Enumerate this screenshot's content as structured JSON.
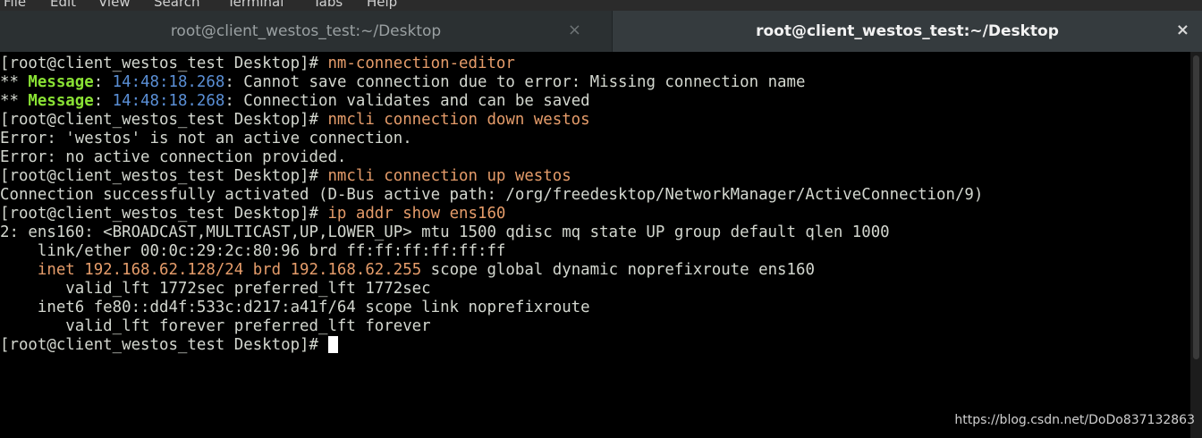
{
  "menubar": {
    "items": [
      "File",
      "Edit",
      "View",
      "Search",
      "Terminal",
      "Tabs",
      "Help"
    ]
  },
  "tabs": [
    {
      "title": "root@client_westos_test:~/Desktop",
      "close": "×",
      "active": false
    },
    {
      "title": "root@client_westos_test:~/Desktop",
      "close": "×",
      "active": true
    }
  ],
  "terminal": {
    "lines": [
      [
        {
          "t": "[root@client_westos_test Desktop]# "
        },
        {
          "t": "nm-connection-editor",
          "c": "cmd"
        }
      ],
      [
        {
          "t": "** "
        },
        {
          "t": "Message",
          "c": "msg"
        },
        {
          "t": ": "
        },
        {
          "t": "14:48:18.268",
          "c": "ts"
        },
        {
          "t": ": Cannot save connection due to error: Missing connection name"
        }
      ],
      [
        {
          "t": "** "
        },
        {
          "t": "Message",
          "c": "msg"
        },
        {
          "t": ": "
        },
        {
          "t": "14:48:18.268",
          "c": "ts"
        },
        {
          "t": ": Connection validates and can be saved"
        }
      ],
      [
        {
          "t": "[root@client_westos_test Desktop]# "
        },
        {
          "t": "nmcli connection down westos",
          "c": "cmd"
        }
      ],
      [
        {
          "t": "Error: 'westos' is not an active connection."
        }
      ],
      [
        {
          "t": "Error: no active connection provided."
        }
      ],
      [
        {
          "t": "[root@client_westos_test Desktop]# "
        },
        {
          "t": "nmcli connection up westos",
          "c": "cmd"
        }
      ],
      [
        {
          "t": "Connection successfully activated (D-Bus active path: /org/freedesktop/NetworkManager/ActiveConnection/9)"
        }
      ],
      [
        {
          "t": "[root@client_westos_test Desktop]# "
        },
        {
          "t": "ip addr show ens160",
          "c": "cmd"
        }
      ],
      [
        {
          "t": "2: ens160: <BROADCAST,MULTICAST,UP,LOWER_UP> mtu 1500 qdisc mq state UP group default qlen 1000"
        }
      ],
      [
        {
          "t": "    link/ether 00:0c:29:2c:80:96 brd ff:ff:ff:ff:ff:ff"
        }
      ],
      [
        {
          "t": "    "
        },
        {
          "t": "inet 192.168.62.128/24 brd 192.168.62.255",
          "c": "hl"
        },
        {
          "t": " scope global dynamic noprefixroute ens160"
        }
      ],
      [
        {
          "t": "       valid_lft 1772sec preferred_lft 1772sec"
        }
      ],
      [
        {
          "t": "    inet6 fe80::dd4f:533c:d217:a41f/64 scope link noprefixroute"
        }
      ],
      [
        {
          "t": "       valid_lft forever preferred_lft forever"
        }
      ],
      [
        {
          "t": "[root@client_westos_test Desktop]# "
        }
      ]
    ]
  },
  "watermark": "https://blog.csdn.net/DoDo837132863",
  "colors": {
    "background": "#000000",
    "text": "#d3d7cf",
    "command": "#e59c6a",
    "message": "#8ae234",
    "timestamp": "#5a8fd6"
  }
}
